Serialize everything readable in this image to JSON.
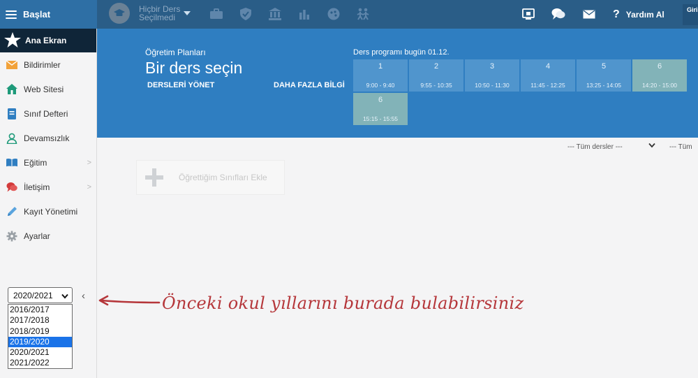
{
  "topbar": {
    "brand_label": "Başlat",
    "course_picker": "Hiçbir Ders Seçilmedi",
    "help_label": "Yardım Al",
    "login_label": "Giri Sor",
    "icons": [
      "briefcase-icon",
      "shield-icon",
      "institution-icon",
      "chart-icon",
      "palette-icon",
      "students-icon"
    ],
    "right_icons": [
      "cast-icon",
      "chat-icon",
      "mail-icon",
      "help-icon"
    ]
  },
  "sidebar": {
    "home_label": "Ana Ekran",
    "items": [
      {
        "label": "Bildirimler",
        "icon": "mail-icon"
      },
      {
        "label": "Web Sitesi",
        "icon": "home-icon"
      },
      {
        "label": "Sınıf Defteri",
        "icon": "notebook-icon"
      },
      {
        "label": "Devamsızlık",
        "icon": "person-icon"
      },
      {
        "label": "Eğitim",
        "icon": "book-icon",
        "has_submenu": true
      },
      {
        "label": "İletişim",
        "icon": "chat-icon",
        "has_submenu": true
      },
      {
        "label": "Kayıt Yönetimi",
        "icon": "pencil-icon"
      },
      {
        "label": "Ayarlar",
        "icon": "gear-icon"
      }
    ],
    "year_select": {
      "value": "2020/2021",
      "options": [
        "2016/2017",
        "2017/2018",
        "2018/2019",
        "2019/2020",
        "2020/2021",
        "2021/2022"
      ],
      "highlighted": "2019/2020"
    },
    "collapse_label": "‹"
  },
  "banner": {
    "plans_label": "Öğretim Planları",
    "title": "Bir ders seçin",
    "manage_label": "DERSLERİ YÖNET",
    "more_info_label": "DAHA FAZLA BİLGİ",
    "today_label": "Ders programı bugün 01.12.",
    "periods": [
      {
        "num": "1",
        "time": "9:00 - 9:40",
        "active": false
      },
      {
        "num": "2",
        "time": "9:55 - 10:35",
        "active": false
      },
      {
        "num": "3",
        "time": "10:50 - 11:30",
        "active": false
      },
      {
        "num": "4",
        "time": "11:45 - 12:25",
        "active": false
      },
      {
        "num": "5",
        "time": "13:25 - 14:05",
        "active": false
      },
      {
        "num": "6",
        "time": "14:20 - 15:00",
        "active": true
      },
      {
        "num": "6",
        "time": "15:15 - 15:55",
        "active": true
      }
    ]
  },
  "content": {
    "filter_lessons": "--- Tüm dersler ---",
    "filter_second": "--- Tüm",
    "add_classes_label": "Öğrettiğim Sınıfları Ekle"
  },
  "annotation": {
    "text": "Önceki okul yıllarını burada bulabilirsiniz",
    "color": "#b5363a"
  }
}
